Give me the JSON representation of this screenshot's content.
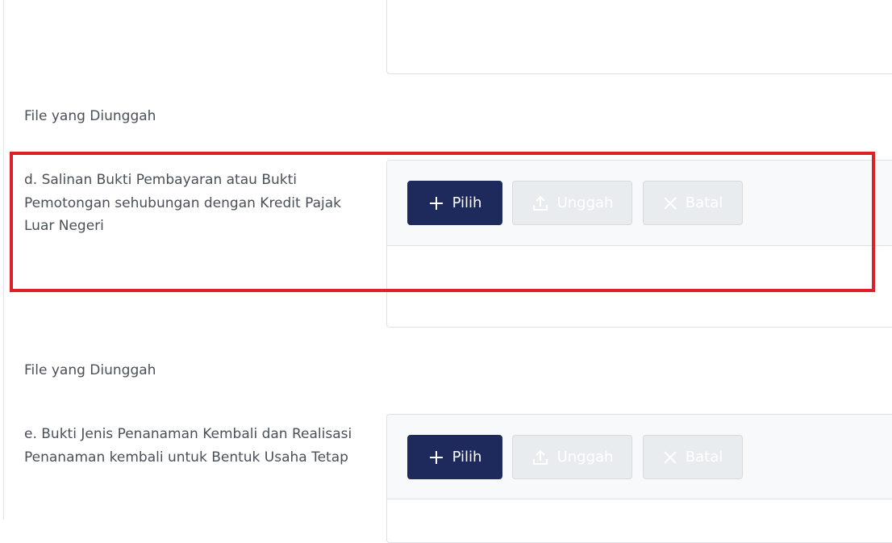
{
  "sections": [
    {
      "uploaded_files_label": "File yang Diunggah"
    },
    {
      "uploaded_files_label": "File yang Diunggah"
    }
  ],
  "item_d": {
    "label": "d. Salinan Bukti Pembayaran atau Bukti Pemotongan sehubungan dengan Kredit Pajak Luar Negeri",
    "choose_label": "Pilih",
    "upload_label": "Unggah",
    "cancel_label": "Batal"
  },
  "item_e": {
    "label": "e. Bukti Jenis Penanaman Kembali dan Realisasi Penanaman kembali untuk Bentuk Usaha Tetap",
    "choose_label": "Pilih",
    "upload_label": "Unggah",
    "cancel_label": "Batal"
  },
  "icons": {
    "choose": "plus-icon",
    "upload": "upload-icon",
    "cancel": "close-icon"
  },
  "colors": {
    "primary": "#1e2a5c",
    "highlight": "#dc2227",
    "disabled_bg": "#e9ecef"
  }
}
